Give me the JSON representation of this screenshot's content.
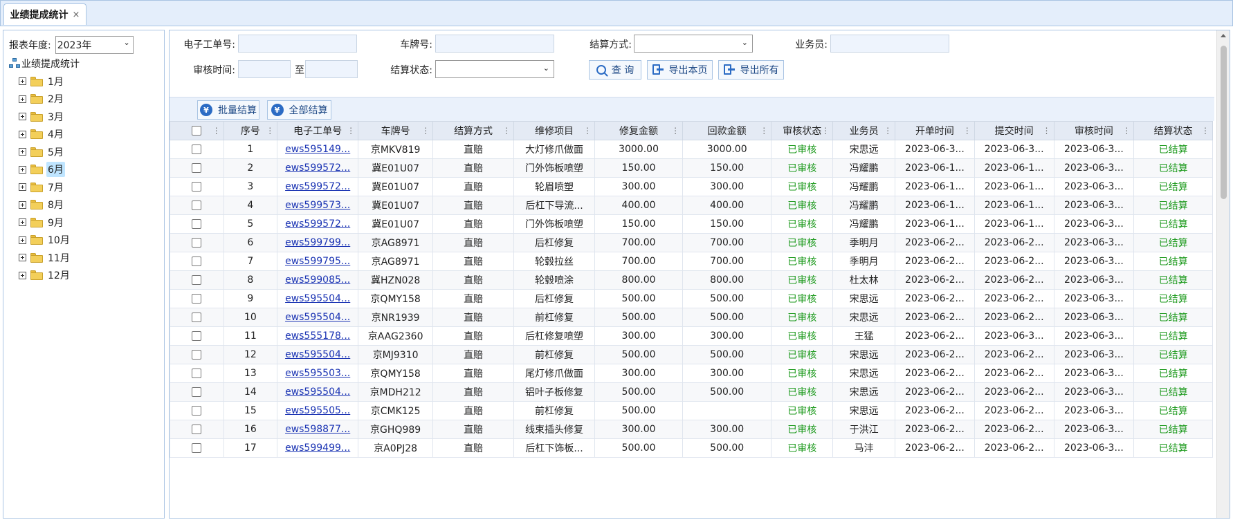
{
  "tab": {
    "label": "业绩提成统计",
    "close": "×"
  },
  "sidebar": {
    "year_label": "报表年度:",
    "year_value": "2023年",
    "root_label": "业绩提成统计",
    "months": [
      "1月",
      "2月",
      "3月",
      "4月",
      "5月",
      "6月",
      "7月",
      "8月",
      "9月",
      "10月",
      "11月",
      "12月"
    ],
    "active_month": "6月"
  },
  "filters": {
    "order_no_label": "电子工单号:",
    "plate_label": "车牌号:",
    "settle_method_label": "结算方式:",
    "salesman_label": "业务员:",
    "audit_time_label": "审核时间:",
    "to_label": "至",
    "settle_status_label": "结算状态:",
    "query_button": "查 询",
    "export_page_button": "导出本页",
    "export_all_button": "导出所有"
  },
  "toolbar": {
    "batch_settle": "批量结算",
    "all_settle": "全部结算",
    "yen": "¥"
  },
  "colors": {
    "accent": "#2b6bc4",
    "link": "#1a33b3",
    "status_green": "#1d9a1d"
  },
  "table": {
    "columns": [
      "序号",
      "电子工单号",
      "车牌号",
      "结算方式",
      "维修项目",
      "修复金额",
      "回款金额",
      "审核状态",
      "业务员",
      "开单时间",
      "提交时间",
      "审核时间",
      "结算状态"
    ],
    "rows": [
      [
        "1",
        "ews595149...",
        "京MKV819",
        "直赔",
        "大灯修爪做面",
        "3000.00",
        "3000.00",
        "已审核",
        "宋思远",
        "2023-06-3...",
        "2023-06-3...",
        "2023-06-3...",
        "已结算"
      ],
      [
        "2",
        "ews599572...",
        "冀E01U07",
        "直赔",
        "门外饰板喷塑",
        "150.00",
        "150.00",
        "已审核",
        "冯耀鹏",
        "2023-06-1...",
        "2023-06-1...",
        "2023-06-3...",
        "已结算"
      ],
      [
        "3",
        "ews599572...",
        "冀E01U07",
        "直赔",
        "轮眉喷塑",
        "300.00",
        "300.00",
        "已审核",
        "冯耀鹏",
        "2023-06-1...",
        "2023-06-1...",
        "2023-06-3...",
        "已结算"
      ],
      [
        "4",
        "ews599573...",
        "冀E01U07",
        "直赔",
        "后杠下导流...",
        "400.00",
        "400.00",
        "已审核",
        "冯耀鹏",
        "2023-06-1...",
        "2023-06-1...",
        "2023-06-3...",
        "已结算"
      ],
      [
        "5",
        "ews599572...",
        "冀E01U07",
        "直赔",
        "门外饰板喷塑",
        "150.00",
        "150.00",
        "已审核",
        "冯耀鹏",
        "2023-06-1...",
        "2023-06-1...",
        "2023-06-3...",
        "已结算"
      ],
      [
        "6",
        "ews599799...",
        "京AG8971",
        "直赔",
        "后杠修复",
        "700.00",
        "700.00",
        "已审核",
        "季明月",
        "2023-06-2...",
        "2023-06-2...",
        "2023-06-3...",
        "已结算"
      ],
      [
        "7",
        "ews599795...",
        "京AG8971",
        "直赔",
        "轮毂拉丝",
        "700.00",
        "700.00",
        "已审核",
        "季明月",
        "2023-06-2...",
        "2023-06-2...",
        "2023-06-3...",
        "已结算"
      ],
      [
        "8",
        "ews599085...",
        "冀HZN028",
        "直赔",
        "轮毂喷涂",
        "800.00",
        "800.00",
        "已审核",
        "杜太林",
        "2023-06-2...",
        "2023-06-2...",
        "2023-06-3...",
        "已结算"
      ],
      [
        "9",
        "ews595504...",
        "京QMY158",
        "直赔",
        "后杠修复",
        "500.00",
        "500.00",
        "已审核",
        "宋思远",
        "2023-06-2...",
        "2023-06-2...",
        "2023-06-3...",
        "已结算"
      ],
      [
        "10",
        "ews595504...",
        "京NR1939",
        "直赔",
        "前杠修复",
        "500.00",
        "500.00",
        "已审核",
        "宋思远",
        "2023-06-2...",
        "2023-06-2...",
        "2023-06-3...",
        "已结算"
      ],
      [
        "11",
        "ews555178...",
        "京AAG2360",
        "直赔",
        "后杠修复喷塑",
        "300.00",
        "300.00",
        "已审核",
        "王猛",
        "2023-06-2...",
        "2023-06-3...",
        "2023-06-3...",
        "已结算"
      ],
      [
        "12",
        "ews595504...",
        "京MJ9310",
        "直赔",
        "前杠修复",
        "500.00",
        "500.00",
        "已审核",
        "宋思远",
        "2023-06-2...",
        "2023-06-2...",
        "2023-06-3...",
        "已结算"
      ],
      [
        "13",
        "ews595503...",
        "京QMY158",
        "直赔",
        "尾灯修爪做面",
        "300.00",
        "300.00",
        "已审核",
        "宋思远",
        "2023-06-2...",
        "2023-06-2...",
        "2023-06-3...",
        "已结算"
      ],
      [
        "14",
        "ews595504...",
        "京MDH212",
        "直赔",
        "铝叶子板修复",
        "500.00",
        "500.00",
        "已审核",
        "宋思远",
        "2023-06-2...",
        "2023-06-2...",
        "2023-06-3...",
        "已结算"
      ],
      [
        "15",
        "ews595505...",
        "京CMK125",
        "直赔",
        "前杠修复",
        "500.00",
        "",
        "已审核",
        "宋思远",
        "2023-06-2...",
        "2023-06-2...",
        "2023-06-3...",
        "已结算"
      ],
      [
        "16",
        "ews598877...",
        "京GHQ989",
        "直赔",
        "线束插头修复",
        "300.00",
        "300.00",
        "已审核",
        "于洪江",
        "2023-06-2...",
        "2023-06-2...",
        "2023-06-3...",
        "已结算"
      ],
      [
        "17",
        "ews599499...",
        "京A0PJ28",
        "直赔",
        "后杠下饰板...",
        "500.00",
        "500.00",
        "已审核",
        "马沣",
        "2023-06-2...",
        "2023-06-2...",
        "2023-06-3...",
        "已结算"
      ]
    ]
  }
}
